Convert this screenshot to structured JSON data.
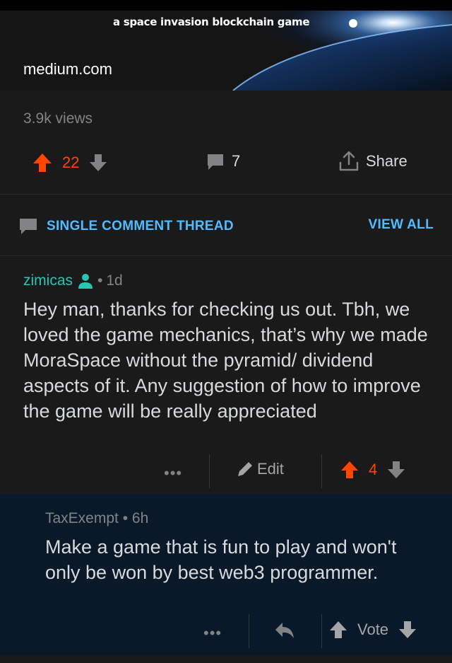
{
  "banner": {
    "tagline": "a space invasion blockchain game",
    "domain": "medium.com"
  },
  "post": {
    "views": "3.9k views",
    "upvotes": "22",
    "comments": "7",
    "share_label": "Share"
  },
  "thread": {
    "title": "SINGLE COMMENT THREAD",
    "view_all": "VIEW ALL"
  },
  "comment": {
    "author": "zimicas",
    "separator": "•",
    "age": "1d",
    "body": "Hey man, thanks for checking us out. Tbh, we loved the game mechanics, that’s why we made MoraSpace without the pyramid/ dividend aspects of it. Any suggestion of how to improve the game will be really appreciated",
    "more_label": "•••",
    "edit_label": "Edit",
    "votes": "4"
  },
  "reply": {
    "header": "TaxExempt • 6h",
    "body": "Make a game that is fun to play and won't only be won by best web3 programmer.",
    "more_label": "•••",
    "vote_label": "Vote"
  },
  "colors": {
    "upvote": "#ff4500",
    "link": "#4fbcff",
    "author": "#26c6b2",
    "reply_bg": "#0a1929"
  },
  "icons": [
    "upvote-arrow-icon",
    "downvote-arrow-icon",
    "comment-bubble-icon",
    "share-icon",
    "user-icon",
    "pencil-icon",
    "reply-arrow-icon"
  ]
}
